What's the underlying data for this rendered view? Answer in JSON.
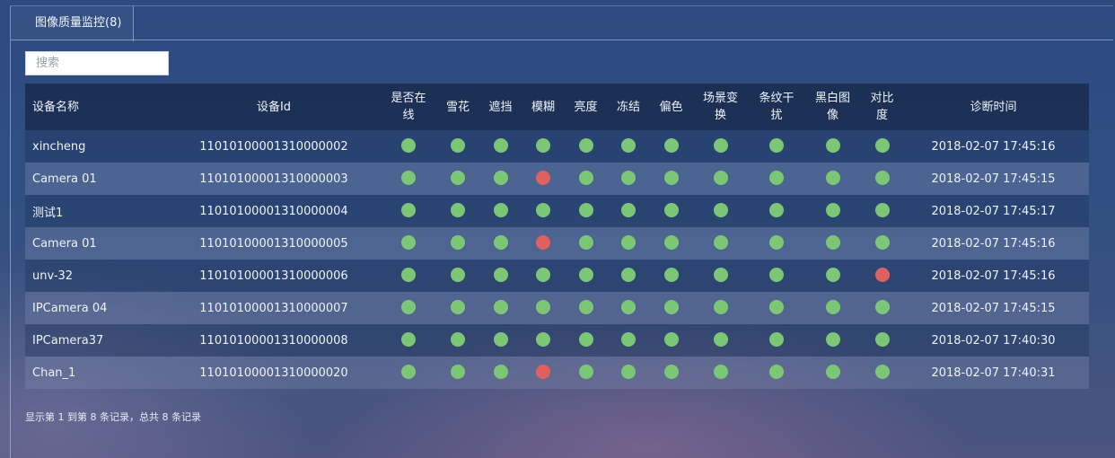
{
  "tab": {
    "label": "图像质量监控(8)"
  },
  "search": {
    "placeholder": "搜索"
  },
  "colors": {
    "ok": "#7cc776",
    "bad": "#e0605f"
  },
  "table": {
    "headers": {
      "name": "设备名称",
      "id": "设备Id",
      "checks": [
        "是否在线",
        "雪花",
        "遮挡",
        "模糊",
        "亮度",
        "冻结",
        "偏色",
        "场景变换",
        "条纹干扰",
        "黑白图像",
        "对比度"
      ],
      "checks_display": [
        "是否在\n线",
        "雪花",
        "遮挡",
        "模糊",
        "亮度",
        "冻结",
        "偏色",
        "场景变\n换",
        "条纹干\n扰",
        "黑白图\n像",
        "对比\n度"
      ],
      "time": "诊断时间"
    },
    "rows": [
      {
        "name": "xincheng",
        "id": "11010100001310000002",
        "status": [
          "ok",
          "ok",
          "ok",
          "ok",
          "ok",
          "ok",
          "ok",
          "ok",
          "ok",
          "ok",
          "ok"
        ],
        "time": "2018-02-07 17:45:16"
      },
      {
        "name": "Camera 01",
        "id": "11010100001310000003",
        "status": [
          "ok",
          "ok",
          "ok",
          "bad",
          "ok",
          "ok",
          "ok",
          "ok",
          "ok",
          "ok",
          "ok"
        ],
        "time": "2018-02-07 17:45:15"
      },
      {
        "name": "测试1",
        "id": "11010100001310000004",
        "status": [
          "ok",
          "ok",
          "ok",
          "ok",
          "ok",
          "ok",
          "ok",
          "ok",
          "ok",
          "ok",
          "ok"
        ],
        "time": "2018-02-07 17:45:17"
      },
      {
        "name": "Camera 01",
        "id": "11010100001310000005",
        "status": [
          "ok",
          "ok",
          "ok",
          "bad",
          "ok",
          "ok",
          "ok",
          "ok",
          "ok",
          "ok",
          "ok"
        ],
        "time": "2018-02-07 17:45:16"
      },
      {
        "name": "unv-32",
        "id": "11010100001310000006",
        "status": [
          "ok",
          "ok",
          "ok",
          "ok",
          "ok",
          "ok",
          "ok",
          "ok",
          "ok",
          "ok",
          "bad"
        ],
        "time": "2018-02-07 17:45:16"
      },
      {
        "name": "IPCamera 04",
        "id": "11010100001310000007",
        "status": [
          "ok",
          "ok",
          "ok",
          "ok",
          "ok",
          "ok",
          "ok",
          "ok",
          "ok",
          "ok",
          "ok"
        ],
        "time": "2018-02-07 17:45:15"
      },
      {
        "name": "IPCamera37",
        "id": "11010100001310000008",
        "status": [
          "ok",
          "ok",
          "ok",
          "ok",
          "ok",
          "ok",
          "ok",
          "ok",
          "ok",
          "ok",
          "ok"
        ],
        "time": "2018-02-07 17:40:30"
      },
      {
        "name": "Chan_1",
        "id": "11010100001310000020",
        "status": [
          "ok",
          "ok",
          "ok",
          "bad",
          "ok",
          "ok",
          "ok",
          "ok",
          "ok",
          "ok",
          "ok"
        ],
        "time": "2018-02-07 17:40:31"
      }
    ]
  },
  "footer": {
    "text": "显示第 1 到第 8 条记录，总共 8 条记录"
  }
}
